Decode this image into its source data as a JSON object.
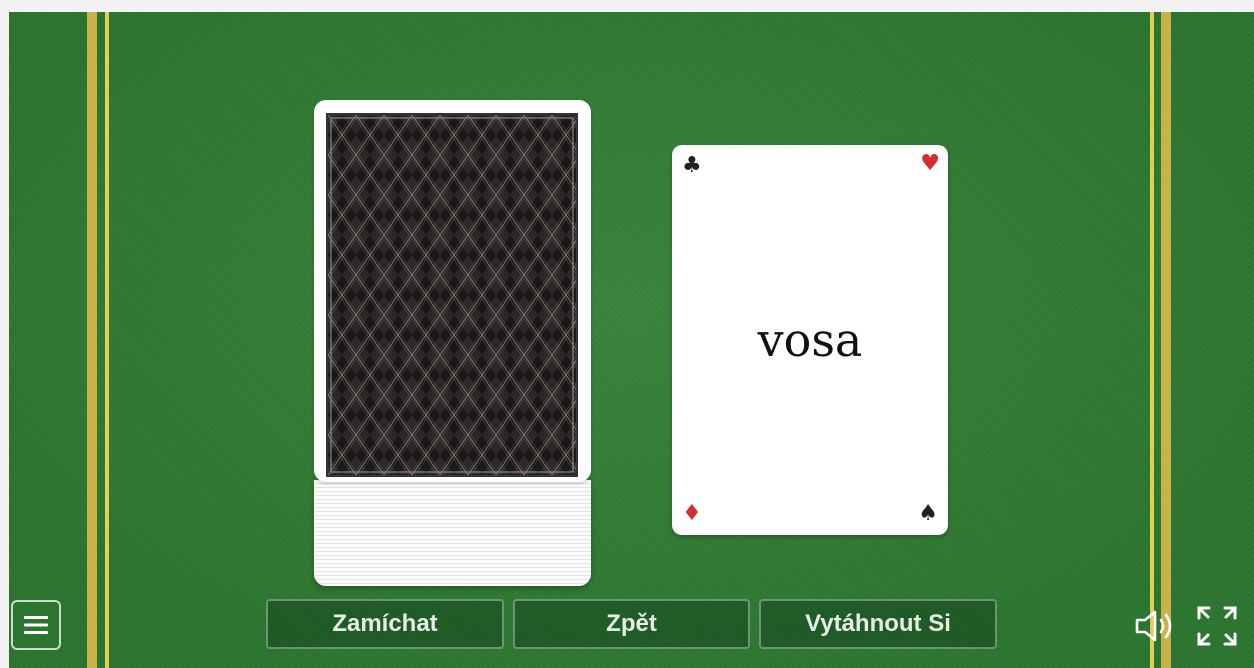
{
  "deck": {
    "icon": "card-back-pattern"
  },
  "card": {
    "word": "vosa",
    "suits": {
      "top_left": "♣",
      "top_right": "♥",
      "bottom_left": "♦",
      "bottom_right": "♠"
    }
  },
  "controls": {
    "shuffle_label": "Zamíchat",
    "back_label": "Zpět",
    "draw_label": "Vytáhnout Si",
    "menu_icon": "hamburger-menu-icon",
    "sound_icon": "speaker-icon",
    "fullscreen_icon": "fullscreen-icon"
  },
  "colors": {
    "felt": "#2e7d32",
    "rail": "#c9b24a",
    "red_suit": "#d32f2f"
  }
}
